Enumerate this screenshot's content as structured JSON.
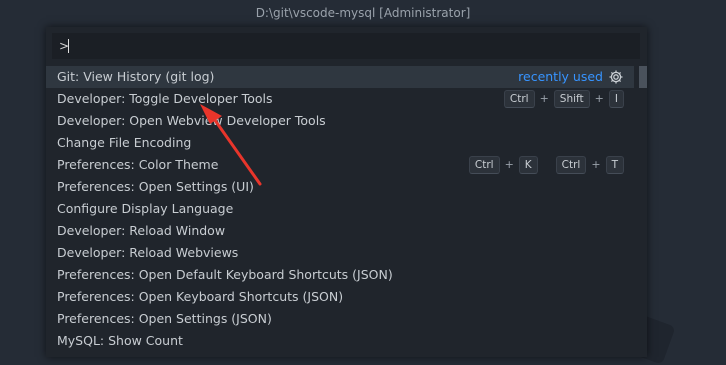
{
  "window": {
    "title": "D:\\git\\vscode-mysql [Administrator]"
  },
  "palette": {
    "input_value": ">",
    "items": [
      {
        "label": "Git: View History (git log)",
        "detail": "recently used"
      },
      {
        "label": "Developer: Toggle Developer Tools",
        "keys": [
          "Ctrl",
          "Shift",
          "I"
        ]
      },
      {
        "label": "Developer: Open Webview Developer Tools"
      },
      {
        "label": "Change File Encoding"
      },
      {
        "label": "Preferences: Color Theme",
        "keys1": [
          "Ctrl",
          "K"
        ],
        "keys2": [
          "Ctrl",
          "T"
        ]
      },
      {
        "label": "Preferences: Open Settings (UI)"
      },
      {
        "label": "Configure Display Language"
      },
      {
        "label": "Developer: Reload Window"
      },
      {
        "label": "Developer: Reload Webviews"
      },
      {
        "label": "Preferences: Open Default Keyboard Shortcuts (JSON)"
      },
      {
        "label": "Preferences: Open Keyboard Shortcuts (JSON)"
      },
      {
        "label": "Preferences: Open Settings (JSON)"
      },
      {
        "label": "MySQL: Show Count"
      }
    ],
    "plus_sign": "+"
  },
  "colors": {
    "accent_blue": "#3794ff",
    "arrow_red": "#e8352b",
    "background": "#252c36",
    "palette_bg": "#20252c",
    "active_row": "#2f3740"
  },
  "icons": {
    "gear": "gear-icon"
  }
}
